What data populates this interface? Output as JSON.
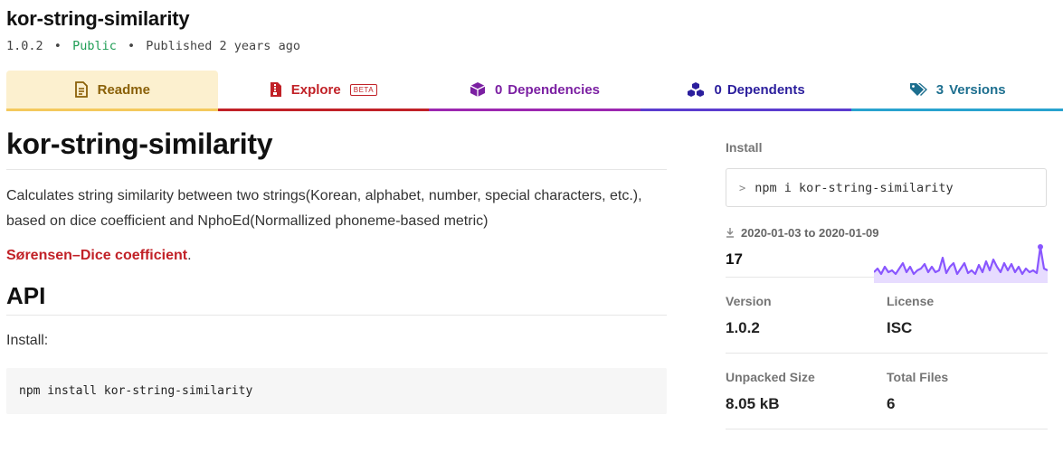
{
  "package": {
    "name": "kor-string-similarity",
    "version": "1.0.2",
    "visibility": "Public",
    "published": "Published 2 years ago",
    "separator": "•"
  },
  "tabs": {
    "readme": {
      "label": "Readme",
      "icon": "readme-icon"
    },
    "explore": {
      "label": "Explore",
      "badge": "BETA",
      "icon": "explore-icon"
    },
    "dependencies": {
      "count": "0",
      "label": "Dependencies",
      "icon": "box-icon"
    },
    "dependents": {
      "count": "0",
      "label": "Dependents",
      "icon": "boxes-icon"
    },
    "versions": {
      "count": "3",
      "label": "Versions",
      "icon": "tags-icon"
    }
  },
  "readme": {
    "title": "kor-string-similarity",
    "description": "Calculates string similarity between two strings(Korean, alphabet, number, special characters, etc.), based on dice coefficient and NphoEd(Normallized phoneme-based metric)",
    "link_text": "Sørensen–Dice coefficient",
    "link_suffix": ".",
    "api_heading": "API",
    "install_label": "Install:",
    "install_code": "npm install kor-string-similarity"
  },
  "sidebar": {
    "install_label": "Install",
    "install_prompt": ">",
    "install_command": "npm i kor-string-similarity",
    "downloads_icon": "download-icon",
    "downloads_range": "2020-01-03 to 2020-01-09",
    "downloads_count": "17",
    "sparkline_color": "#8956ff",
    "version_label": "Version",
    "version_value": "1.0.2",
    "license_label": "License",
    "license_value": "ISC",
    "unpacked_label": "Unpacked Size",
    "unpacked_value": "8.05 kB",
    "files_label": "Total Files",
    "files_value": "6"
  }
}
